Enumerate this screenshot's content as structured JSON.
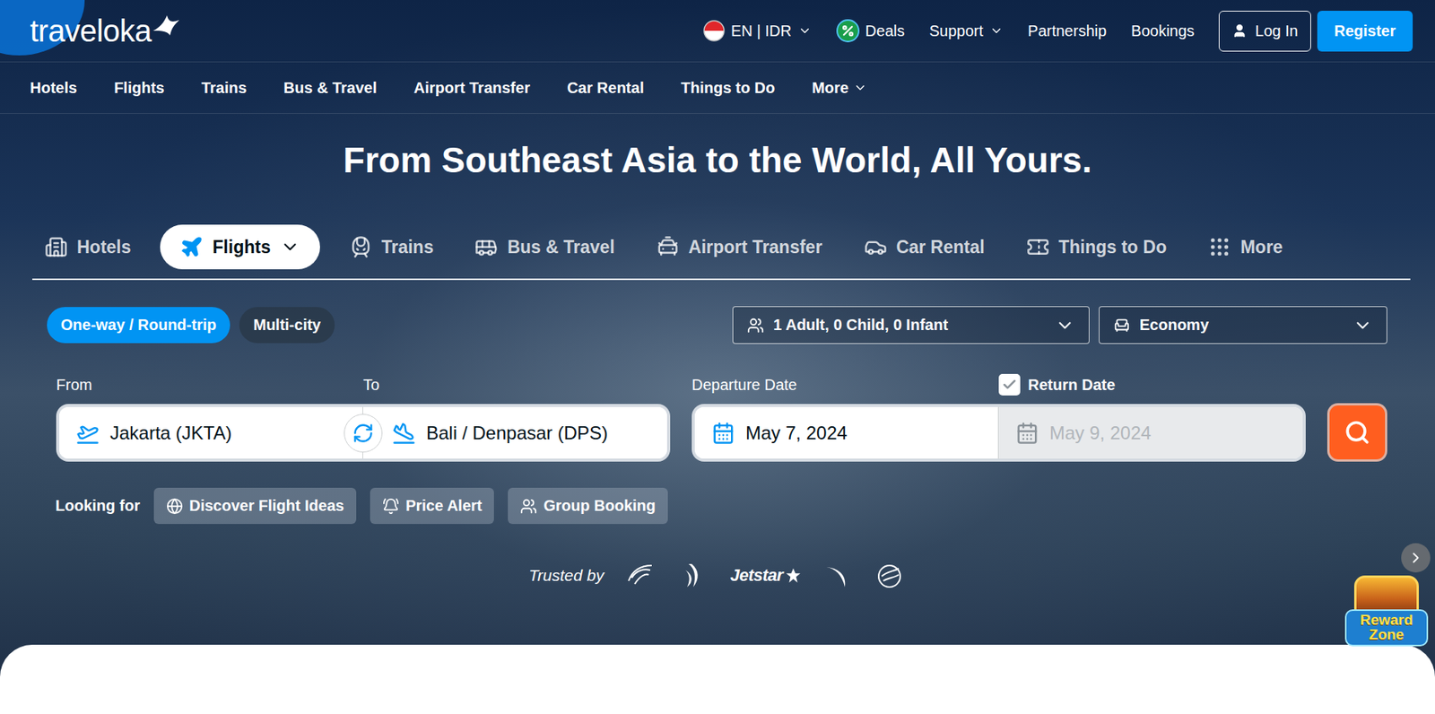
{
  "logo": "traveloka",
  "header": {
    "locale": "EN | IDR",
    "links": [
      {
        "label": "Deals",
        "kind": "deals"
      },
      {
        "label": "Support",
        "kind": "menu"
      },
      {
        "label": "Partnership",
        "kind": "plain"
      },
      {
        "label": "Bookings",
        "kind": "plain"
      }
    ],
    "login": "Log In",
    "register": "Register"
  },
  "nav": [
    {
      "label": "Hotels",
      "kind": "plain"
    },
    {
      "label": "Flights",
      "kind": "plain"
    },
    {
      "label": "Trains",
      "kind": "plain"
    },
    {
      "label": "Bus & Travel",
      "kind": "plain"
    },
    {
      "label": "Airport Transfer",
      "kind": "plain"
    },
    {
      "label": "Car Rental",
      "kind": "plain"
    },
    {
      "label": "Things to Do",
      "kind": "plain"
    },
    {
      "label": "More",
      "kind": "menu"
    }
  ],
  "headline": "From Southeast Asia to the World, All Yours.",
  "products": [
    {
      "label": "Hotels",
      "kind": "hotel",
      "selected": false
    },
    {
      "label": "Flights",
      "kind": "flight",
      "selected": true
    },
    {
      "label": "Trains",
      "kind": "train",
      "selected": false
    },
    {
      "label": "Bus & Travel",
      "kind": "bus",
      "selected": false
    },
    {
      "label": "Airport Transfer",
      "kind": "transfer",
      "selected": false
    },
    {
      "label": "Car Rental",
      "kind": "car",
      "selected": false
    },
    {
      "label": "Things to Do",
      "kind": "activity",
      "selected": false
    },
    {
      "label": "More",
      "kind": "more",
      "selected": false
    }
  ],
  "trip_types": [
    {
      "label": "One-way / Round-trip",
      "selected": true
    },
    {
      "label": "Multi-city",
      "selected": false
    }
  ],
  "passengers": "1 Adult, 0 Child, 0 Infant",
  "cabin": "Economy",
  "from": {
    "label": "From",
    "value": "Jakarta (JKTA)"
  },
  "to": {
    "label": "To",
    "value": "Bali / Denpasar (DPS)"
  },
  "departure": {
    "label": "Departure Date",
    "value": "May 7, 2024"
  },
  "return": {
    "label": "Return Date",
    "checked": true,
    "value": "May 9, 2024",
    "disabled": true
  },
  "looking_for": {
    "label": "Looking for",
    "chips": [
      {
        "label": "Discover Flight Ideas",
        "kind": "ideas"
      },
      {
        "label": "Price Alert",
        "kind": "alert"
      },
      {
        "label": "Group Booking",
        "kind": "group"
      }
    ]
  },
  "trusted_by": {
    "label": "Trusted by",
    "airlines": [
      {
        "kind": "garuda"
      },
      {
        "kind": "singapore"
      },
      {
        "kind": "jetstar",
        "label": "Jetstar"
      },
      {
        "kind": "cathay"
      },
      {
        "kind": "qatar"
      }
    ]
  },
  "reward_badge": "Reward Zone"
}
